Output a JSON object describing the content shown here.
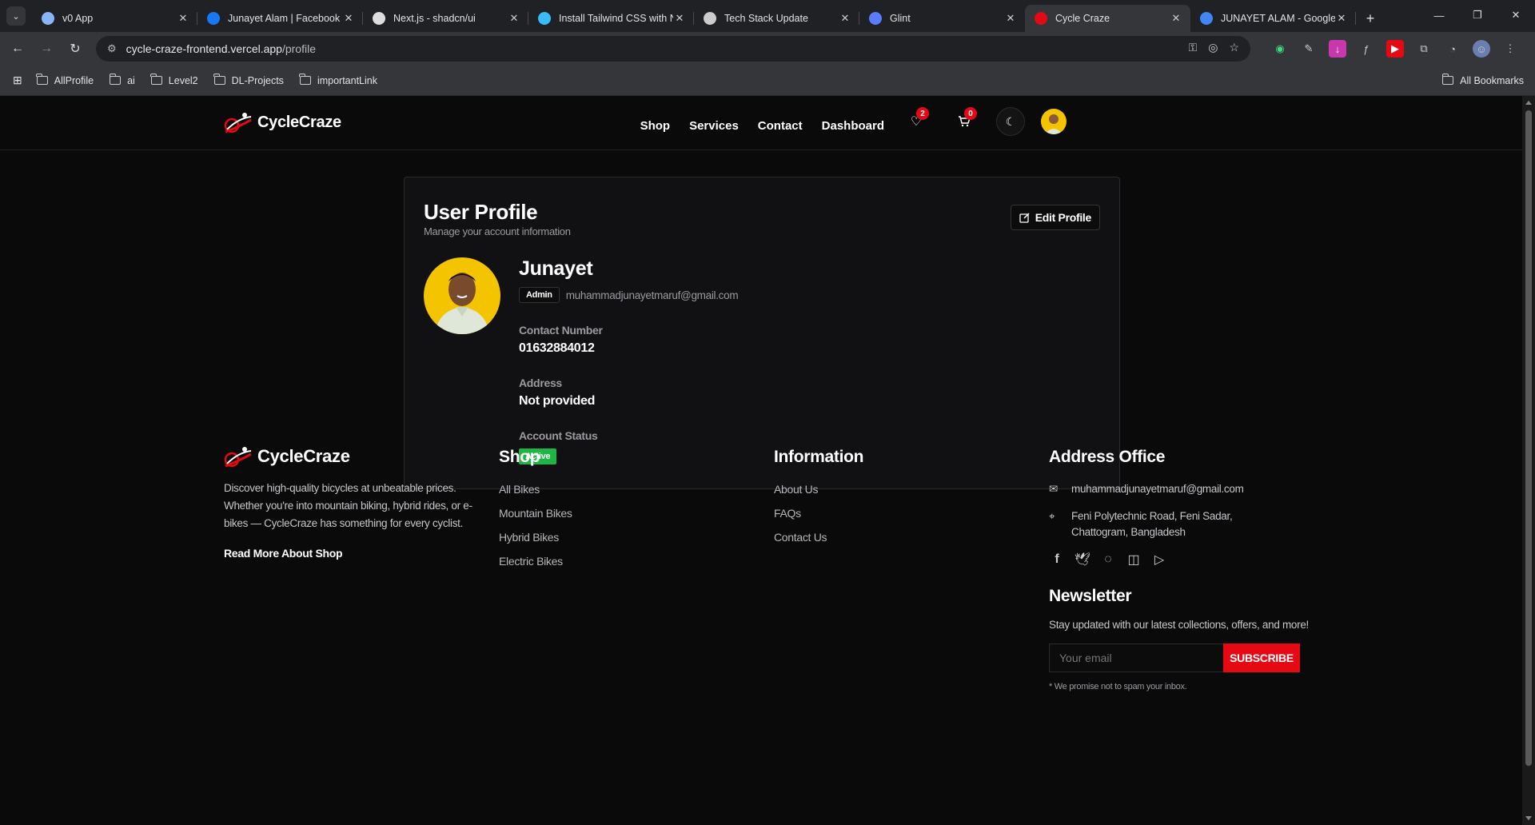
{
  "browser": {
    "tabs": [
      {
        "title": "v0 App",
        "fav": "#8ab4f8"
      },
      {
        "title": "Junayet Alam | Facebook",
        "fav": "#1877f2"
      },
      {
        "title": "Next.js - shadcn/ui",
        "fav": "#dddddd"
      },
      {
        "title": "Install Tailwind CSS with N",
        "fav": "#38bdf8"
      },
      {
        "title": "Tech Stack Update",
        "fav": "#cccccc"
      },
      {
        "title": "Glint",
        "fav": "#5b7bff"
      },
      {
        "title": "Cycle Craze",
        "fav": "#e50914"
      },
      {
        "title": "JUNAYET ALAM - Google",
        "fav": "#4285f4"
      }
    ],
    "active_tab": 6,
    "url_host": "cycle-craze-frontend.vercel.app",
    "url_path": "/profile",
    "bookmarks": [
      "AllProfile",
      "ai",
      "Level2",
      "DL-Projects",
      "importantLink"
    ],
    "all_bookmarks": "All Bookmarks"
  },
  "site": {
    "brand": "CycleCraze",
    "nav": [
      "Shop",
      "Services",
      "Contact",
      "Dashboard"
    ],
    "wishlist_count": "2",
    "cart_count": "0"
  },
  "profile": {
    "title": "User Profile",
    "subtitle": "Manage your account information",
    "edit_label": "Edit Profile",
    "name": "Junayet",
    "role": "Admin",
    "email": "muhammadjunayetmaruf@gmail.com",
    "contact_label": "Contact Number",
    "contact_value": "01632884012",
    "address_label": "Address",
    "address_value": "Not provided",
    "status_label": "Account Status",
    "status_value": "Active"
  },
  "footer": {
    "brand": "CycleCraze",
    "description": "Discover high-quality bicycles at unbeatable prices. Whether you're into mountain biking, hybrid rides, or e-bikes — CycleCraze has something for every cyclist.",
    "read_more": "Read More About Shop",
    "shop_title": "Shop",
    "shop_links": [
      "All Bikes",
      "Mountain Bikes",
      "Hybrid Bikes",
      "Electric Bikes"
    ],
    "info_title": "Information",
    "info_links": [
      "About Us",
      "FAQs",
      "Contact Us"
    ],
    "address_title": "Address Office",
    "address_email": "muhammadjunayetmaruf@gmail.com",
    "address_location": "Feni Polytechnic Road, Feni Sadar, Chattogram, Bangladesh",
    "newsletter_title": "Newsletter",
    "newsletter_text": "Stay updated with our latest collections, offers, and more!",
    "newsletter_placeholder": "Your email",
    "subscribe_label": "SUBSCRIBE",
    "promise": "* We promise not to spam your inbox."
  },
  "colors": {
    "accent": "#e50914",
    "active": "#1fb545",
    "avatar_bg": "#f5c400"
  }
}
